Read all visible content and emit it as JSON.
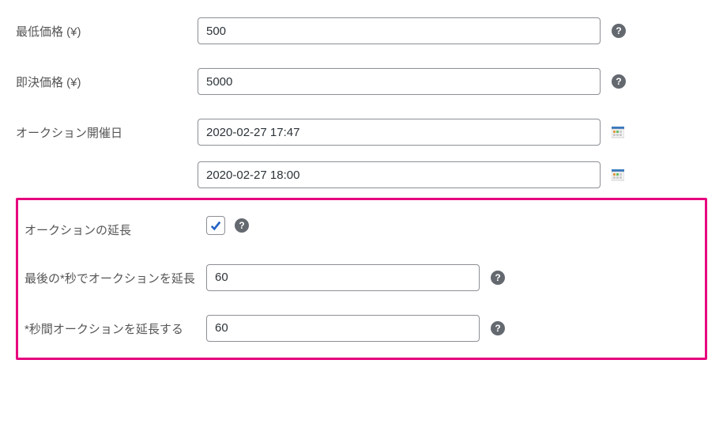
{
  "min_price": {
    "label": "最低価格 (¥)",
    "value": "500"
  },
  "buynow_price": {
    "label": "即決価格 (¥)",
    "value": "5000"
  },
  "auction_dates": {
    "label": "オークション開催日",
    "start": "2020-02-27 17:47",
    "end": "2020-02-27 18:00"
  },
  "extend": {
    "label": "オークションの延長",
    "checked": true
  },
  "extend_threshold": {
    "label": "最後の*秒でオークションを延長",
    "value": "60"
  },
  "extend_by": {
    "label": "*秒間オークションを延長する",
    "value": "60"
  }
}
